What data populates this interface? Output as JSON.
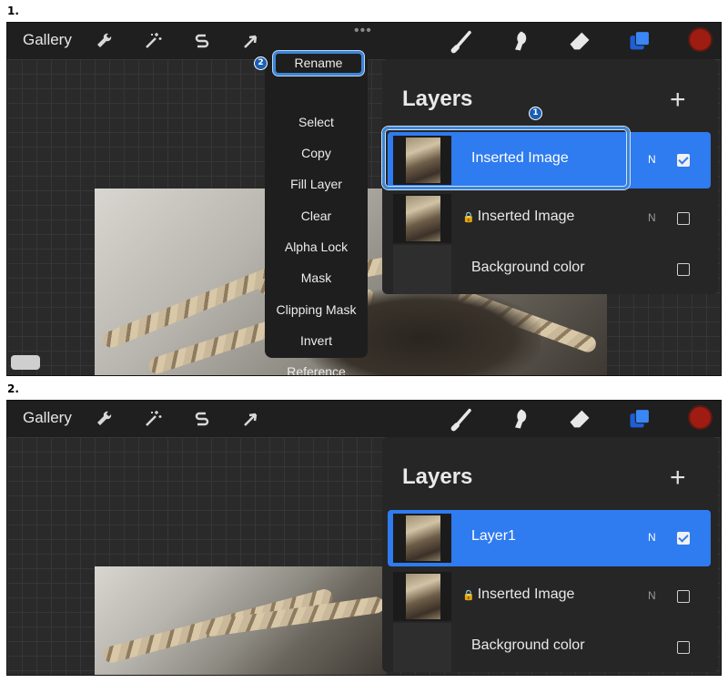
{
  "steps": [
    "1.",
    "2."
  ],
  "toolbar": {
    "gallery_label": "Gallery",
    "dots": "•••",
    "color_swatch": "#9e1c12",
    "icons": [
      "wrench-icon",
      "magic-wand-icon",
      "selection-s-icon",
      "transform-arrow-icon",
      "brush-icon",
      "smudge-icon",
      "eraser-icon",
      "layers-icon"
    ]
  },
  "menu": {
    "items": [
      "Rename",
      "Select",
      "Copy",
      "Fill Layer",
      "Clear",
      "Alpha Lock",
      "Mask",
      "Clipping Mask",
      "Invert",
      "Reference"
    ]
  },
  "markers": [
    "1",
    "2"
  ],
  "panel1": {
    "layers_title": "Layers",
    "plus": "+",
    "rows": [
      {
        "name": "Inserted Image",
        "blend": "N",
        "checked": true,
        "active": true,
        "locked": false
      },
      {
        "name": "Inserted Image",
        "blend": "N",
        "checked": false,
        "active": false,
        "locked": true
      },
      {
        "name": "Background color",
        "blend": "",
        "checked": false,
        "active": false,
        "locked": false
      }
    ]
  },
  "panel2": {
    "layers_title": "Layers",
    "plus": "+",
    "rows": [
      {
        "name": "Layer1",
        "blend": "N",
        "checked": true,
        "active": true,
        "locked": false
      },
      {
        "name": "Inserted Image",
        "blend": "N",
        "checked": false,
        "active": false,
        "locked": true
      },
      {
        "name": "Background color",
        "blend": "",
        "checked": false,
        "active": false,
        "locked": false
      }
    ]
  },
  "colors": {
    "accent": "#2f7bf0",
    "highlight_outline": "#3d86d6",
    "marker": "#1a5fb4"
  }
}
